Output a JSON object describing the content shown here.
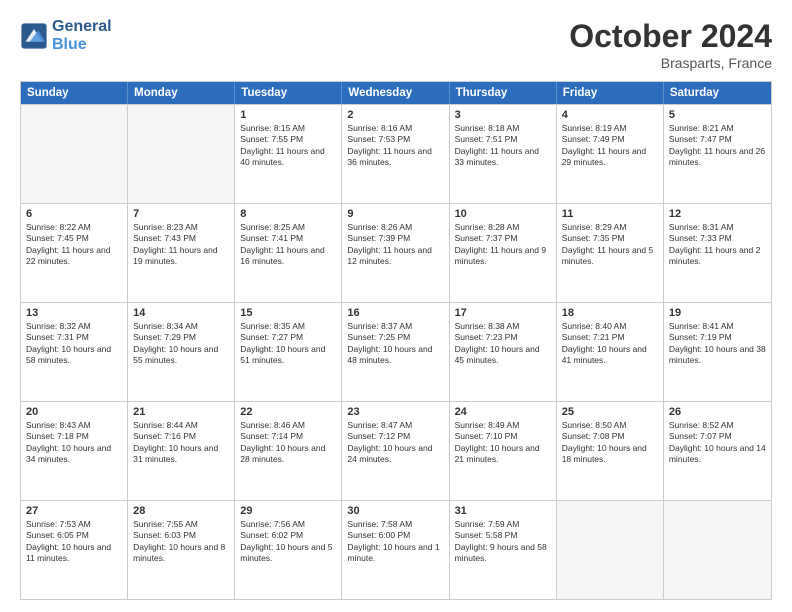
{
  "logo": {
    "line1": "General",
    "line2": "Blue"
  },
  "title": "October 2024",
  "location": "Brasparts, France",
  "header_days": [
    "Sunday",
    "Monday",
    "Tuesday",
    "Wednesday",
    "Thursday",
    "Friday",
    "Saturday"
  ],
  "weeks": [
    [
      {
        "day": "",
        "sunrise": "",
        "sunset": "",
        "daylight": "",
        "empty": true
      },
      {
        "day": "",
        "sunrise": "",
        "sunset": "",
        "daylight": "",
        "empty": true
      },
      {
        "day": "1",
        "sunrise": "Sunrise: 8:15 AM",
        "sunset": "Sunset: 7:55 PM",
        "daylight": "Daylight: 11 hours and 40 minutes."
      },
      {
        "day": "2",
        "sunrise": "Sunrise: 8:16 AM",
        "sunset": "Sunset: 7:53 PM",
        "daylight": "Daylight: 11 hours and 36 minutes."
      },
      {
        "day": "3",
        "sunrise": "Sunrise: 8:18 AM",
        "sunset": "Sunset: 7:51 PM",
        "daylight": "Daylight: 11 hours and 33 minutes."
      },
      {
        "day": "4",
        "sunrise": "Sunrise: 8:19 AM",
        "sunset": "Sunset: 7:49 PM",
        "daylight": "Daylight: 11 hours and 29 minutes."
      },
      {
        "day": "5",
        "sunrise": "Sunrise: 8:21 AM",
        "sunset": "Sunset: 7:47 PM",
        "daylight": "Daylight: 11 hours and 26 minutes."
      }
    ],
    [
      {
        "day": "6",
        "sunrise": "Sunrise: 8:22 AM",
        "sunset": "Sunset: 7:45 PM",
        "daylight": "Daylight: 11 hours and 22 minutes."
      },
      {
        "day": "7",
        "sunrise": "Sunrise: 8:23 AM",
        "sunset": "Sunset: 7:43 PM",
        "daylight": "Daylight: 11 hours and 19 minutes."
      },
      {
        "day": "8",
        "sunrise": "Sunrise: 8:25 AM",
        "sunset": "Sunset: 7:41 PM",
        "daylight": "Daylight: 11 hours and 16 minutes."
      },
      {
        "day": "9",
        "sunrise": "Sunrise: 8:26 AM",
        "sunset": "Sunset: 7:39 PM",
        "daylight": "Daylight: 11 hours and 12 minutes."
      },
      {
        "day": "10",
        "sunrise": "Sunrise: 8:28 AM",
        "sunset": "Sunset: 7:37 PM",
        "daylight": "Daylight: 11 hours and 9 minutes."
      },
      {
        "day": "11",
        "sunrise": "Sunrise: 8:29 AM",
        "sunset": "Sunset: 7:35 PM",
        "daylight": "Daylight: 11 hours and 5 minutes."
      },
      {
        "day": "12",
        "sunrise": "Sunrise: 8:31 AM",
        "sunset": "Sunset: 7:33 PM",
        "daylight": "Daylight: 11 hours and 2 minutes."
      }
    ],
    [
      {
        "day": "13",
        "sunrise": "Sunrise: 8:32 AM",
        "sunset": "Sunset: 7:31 PM",
        "daylight": "Daylight: 10 hours and 58 minutes."
      },
      {
        "day": "14",
        "sunrise": "Sunrise: 8:34 AM",
        "sunset": "Sunset: 7:29 PM",
        "daylight": "Daylight: 10 hours and 55 minutes."
      },
      {
        "day": "15",
        "sunrise": "Sunrise: 8:35 AM",
        "sunset": "Sunset: 7:27 PM",
        "daylight": "Daylight: 10 hours and 51 minutes."
      },
      {
        "day": "16",
        "sunrise": "Sunrise: 8:37 AM",
        "sunset": "Sunset: 7:25 PM",
        "daylight": "Daylight: 10 hours and 48 minutes."
      },
      {
        "day": "17",
        "sunrise": "Sunrise: 8:38 AM",
        "sunset": "Sunset: 7:23 PM",
        "daylight": "Daylight: 10 hours and 45 minutes."
      },
      {
        "day": "18",
        "sunrise": "Sunrise: 8:40 AM",
        "sunset": "Sunset: 7:21 PM",
        "daylight": "Daylight: 10 hours and 41 minutes."
      },
      {
        "day": "19",
        "sunrise": "Sunrise: 8:41 AM",
        "sunset": "Sunset: 7:19 PM",
        "daylight": "Daylight: 10 hours and 38 minutes."
      }
    ],
    [
      {
        "day": "20",
        "sunrise": "Sunrise: 8:43 AM",
        "sunset": "Sunset: 7:18 PM",
        "daylight": "Daylight: 10 hours and 34 minutes."
      },
      {
        "day": "21",
        "sunrise": "Sunrise: 8:44 AM",
        "sunset": "Sunset: 7:16 PM",
        "daylight": "Daylight: 10 hours and 31 minutes."
      },
      {
        "day": "22",
        "sunrise": "Sunrise: 8:46 AM",
        "sunset": "Sunset: 7:14 PM",
        "daylight": "Daylight: 10 hours and 28 minutes."
      },
      {
        "day": "23",
        "sunrise": "Sunrise: 8:47 AM",
        "sunset": "Sunset: 7:12 PM",
        "daylight": "Daylight: 10 hours and 24 minutes."
      },
      {
        "day": "24",
        "sunrise": "Sunrise: 8:49 AM",
        "sunset": "Sunset: 7:10 PM",
        "daylight": "Daylight: 10 hours and 21 minutes."
      },
      {
        "day": "25",
        "sunrise": "Sunrise: 8:50 AM",
        "sunset": "Sunset: 7:08 PM",
        "daylight": "Daylight: 10 hours and 18 minutes."
      },
      {
        "day": "26",
        "sunrise": "Sunrise: 8:52 AM",
        "sunset": "Sunset: 7:07 PM",
        "daylight": "Daylight: 10 hours and 14 minutes."
      }
    ],
    [
      {
        "day": "27",
        "sunrise": "Sunrise: 7:53 AM",
        "sunset": "Sunset: 6:05 PM",
        "daylight": "Daylight: 10 hours and 11 minutes."
      },
      {
        "day": "28",
        "sunrise": "Sunrise: 7:55 AM",
        "sunset": "Sunset: 6:03 PM",
        "daylight": "Daylight: 10 hours and 8 minutes."
      },
      {
        "day": "29",
        "sunrise": "Sunrise: 7:56 AM",
        "sunset": "Sunset: 6:02 PM",
        "daylight": "Daylight: 10 hours and 5 minutes."
      },
      {
        "day": "30",
        "sunrise": "Sunrise: 7:58 AM",
        "sunset": "Sunset: 6:00 PM",
        "daylight": "Daylight: 10 hours and 1 minute."
      },
      {
        "day": "31",
        "sunrise": "Sunrise: 7:59 AM",
        "sunset": "Sunset: 5:58 PM",
        "daylight": "Daylight: 9 hours and 58 minutes."
      },
      {
        "day": "",
        "sunrise": "",
        "sunset": "",
        "daylight": "",
        "empty": true
      },
      {
        "day": "",
        "sunrise": "",
        "sunset": "",
        "daylight": "",
        "empty": true
      }
    ]
  ]
}
